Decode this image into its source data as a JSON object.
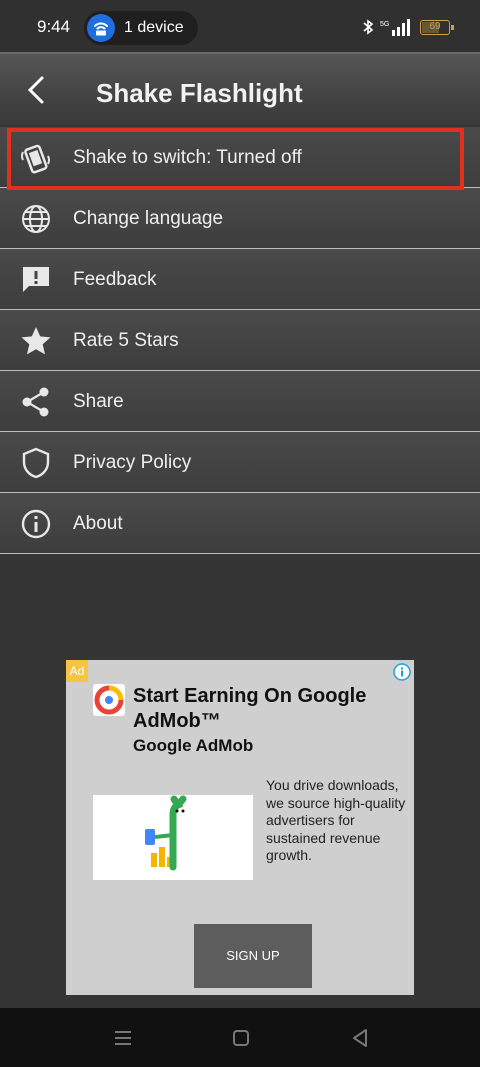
{
  "status_bar": {
    "time": "9:44",
    "device_pill": "1 device",
    "battery": "69",
    "network": "5G"
  },
  "app_bar": {
    "title": "Shake Flashlight"
  },
  "menu": {
    "items": [
      {
        "label": "Shake to switch: Turned off",
        "icon": "shake-phone-icon"
      },
      {
        "label": "Change language",
        "icon": "globe-icon"
      },
      {
        "label": "Feedback",
        "icon": "feedback-icon"
      },
      {
        "label": "Rate 5 Stars",
        "icon": "star-icon"
      },
      {
        "label": "Share",
        "icon": "share-icon"
      },
      {
        "label": "Privacy Policy",
        "icon": "shield-icon"
      },
      {
        "label": "About",
        "icon": "info-icon"
      }
    ]
  },
  "ad": {
    "badge": "Ad",
    "title": "Start Earning On Google AdMob™",
    "advertiser": "Google AdMob",
    "body": "You drive downloads, we source high-quality advertisers for sustained revenue growth.",
    "cta": "SIGN UP"
  },
  "colors": {
    "highlight": "#e0301e",
    "ad_badge": "#f5c542",
    "pill_icon": "#1f6fe0"
  }
}
